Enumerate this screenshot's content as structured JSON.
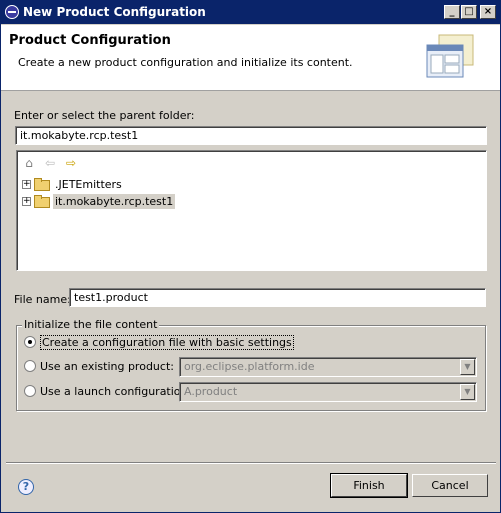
{
  "window": {
    "title": "New Product Configuration"
  },
  "header": {
    "title": "Product Configuration",
    "description": "Create a new product configuration and initialize its content."
  },
  "parent_folder": {
    "label": "Enter or select the parent folder:",
    "value": "it.mokabyte.rcp.test1"
  },
  "tree": {
    "items": [
      {
        "label": ".JETEmitters",
        "selected": false
      },
      {
        "label": "it.mokabyte.rcp.test1",
        "selected": true
      }
    ]
  },
  "file_name": {
    "label": "File name:",
    "value": "test1.product"
  },
  "init": {
    "title": "Initialize the file content",
    "option_basic": "Create a configuration file with basic settings",
    "option_existing": "Use an existing product:",
    "existing_value": "org.eclipse.platform.ide",
    "option_launch": "Use a launch configuration:",
    "launch_value": "A.product",
    "selected": "basic"
  },
  "buttons": {
    "finish": "Finish",
    "cancel": "Cancel"
  }
}
